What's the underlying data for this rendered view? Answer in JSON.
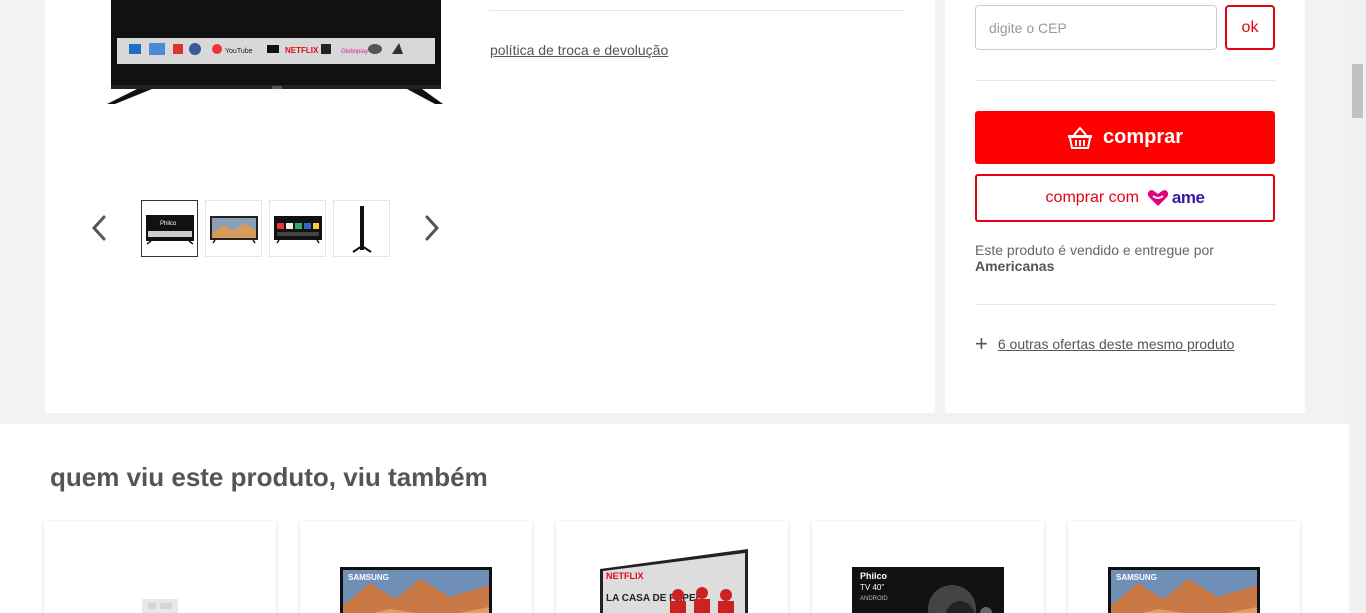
{
  "gallery": {
    "main_tv_logos": [
      "Globoplay",
      "YouTube",
      "NETFLIX",
      "Dolby"
    ],
    "thumb_labels": [
      "Philco"
    ],
    "policy_link": "política de troca e devolução",
    "prev_icon": "chevron-left-icon",
    "next_icon": "chevron-right-icon"
  },
  "buybox": {
    "cep_placeholder": "digite o CEP",
    "ok_label": "ok",
    "buy_label": "comprar",
    "buy_icon": "basket-icon",
    "ame_label": "comprar com",
    "ame_brand": "ame",
    "seller_text": "Este produto é vendido e entregue por",
    "seller_name": "Americanas",
    "offers_label": "6 outras ofertas deste mesmo produto",
    "colors": {
      "primary": "#ff0000",
      "ame": "#3a1a9e",
      "ame_heart": "#e4007c"
    }
  },
  "reco": {
    "title": "quem viu este produto, viu também",
    "cards": [
      {
        "label": ""
      },
      {
        "label": "SAMSUNG"
      },
      {
        "label": "NETFLIX",
        "sub": "LA CASA DE PAPEL"
      },
      {
        "label": "Philco",
        "sub": "TV 40\"",
        "tag": "ANDROID"
      },
      {
        "label": "SAMSUNG"
      }
    ]
  }
}
